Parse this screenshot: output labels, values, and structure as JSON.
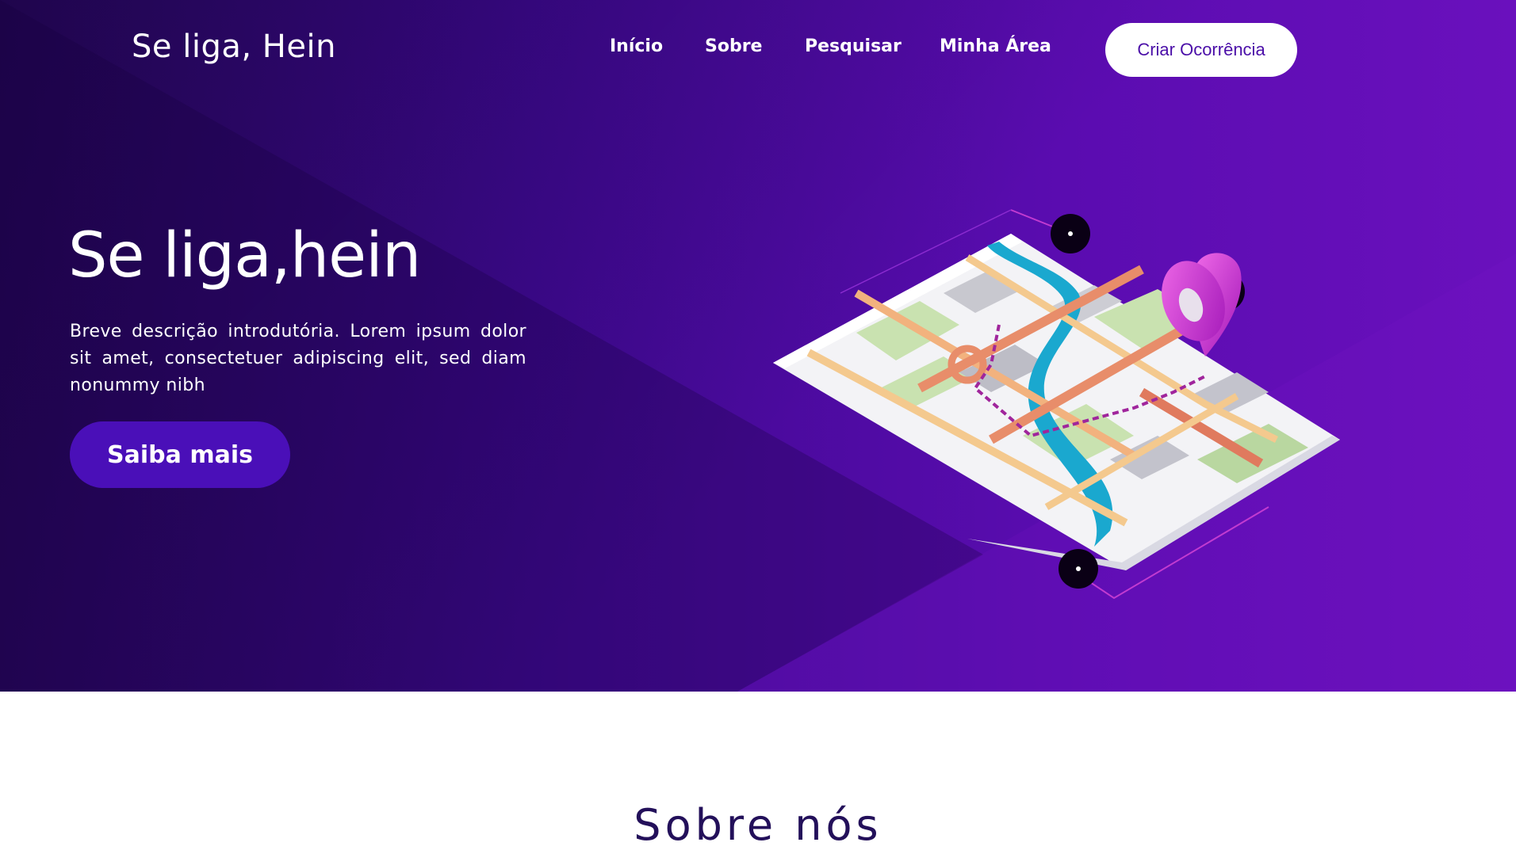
{
  "header": {
    "logo": "Se liga, Hein",
    "nav": [
      "Início",
      "Sobre",
      "Pesquisar",
      "Minha Área"
    ],
    "cta_label": "Criar Ocorrência"
  },
  "hero": {
    "title": "Se liga,hein",
    "description": "Breve descrição introdutória. Lorem ipsum dolor sit amet, consectetuer adipiscing elit, sed diam nonummy nibh",
    "button_label": "Saiba mais",
    "illustration_icon": "map-pin-icon"
  },
  "about": {
    "title": "Sobre nós"
  },
  "colors": {
    "hero_start": "#2a0760",
    "hero_end": "#6a10bd",
    "button_bg": "#4a0fb8",
    "cta_text": "#4b0fa8",
    "about_title": "#23105a",
    "pin": "#d23ad6"
  }
}
